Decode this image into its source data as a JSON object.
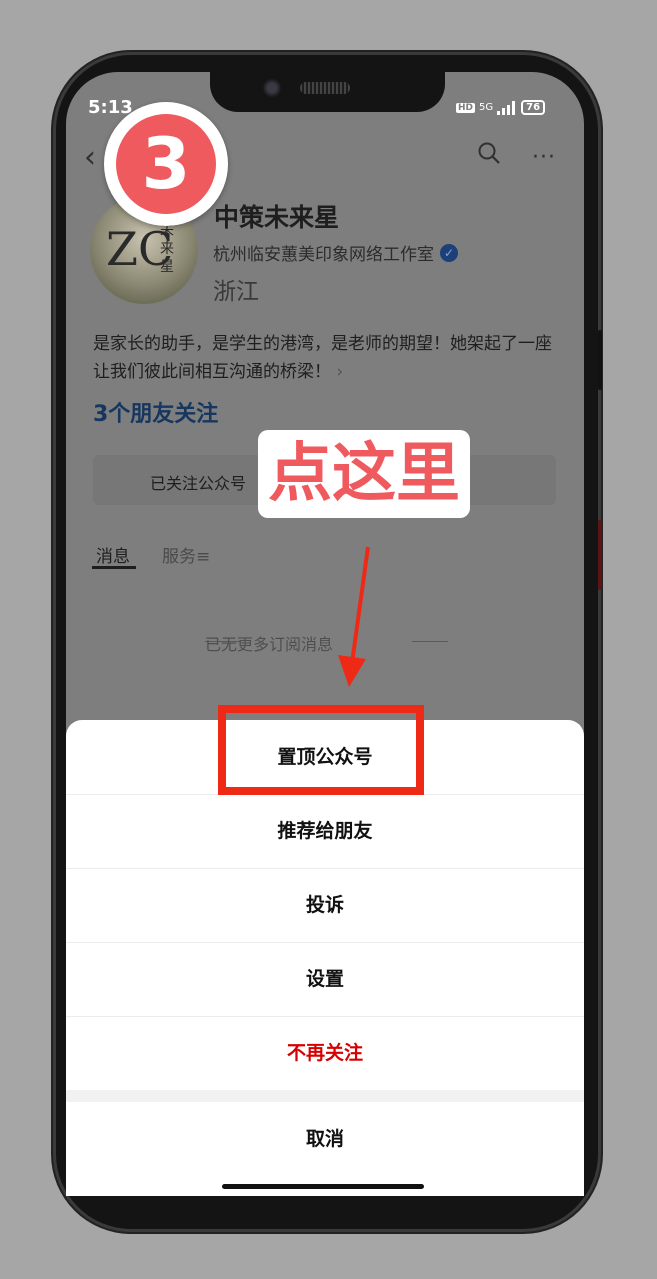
{
  "status_bar": {
    "time": "5:13",
    "hd": "HD",
    "network": "5G",
    "battery": "76"
  },
  "header": {
    "back_icon": "chevron-left-icon",
    "search_icon": "search-icon",
    "more_icon": "more-dots-icon"
  },
  "profile": {
    "avatar_text": "ZC",
    "avatar_subtext": "未来星",
    "name": "中策未来星",
    "organization": "杭州临安蕙美印象网络工作室",
    "verified_icon": "verified-check-icon",
    "region": "浙江",
    "description": "是家长的助手，是学生的港湾，是老师的期望！她架起了一座让我们彼此间相互沟通的桥梁！",
    "description_arrow": "›",
    "friends_following": "3个朋友关注",
    "follow_status": "已关注公众号"
  },
  "tabs": [
    {
      "label": "消息"
    },
    {
      "label": "服务≡"
    }
  ],
  "empty_note": "已无更多订阅消息",
  "action_sheet": {
    "items": [
      {
        "label": "置顶公众号"
      },
      {
        "label": "推荐给朋友"
      },
      {
        "label": "投诉"
      },
      {
        "label": "设置"
      },
      {
        "label": "不再关注",
        "danger": true
      }
    ],
    "cancel": "取消"
  },
  "annotation": {
    "step_number": "3",
    "callout_text": "点这里",
    "highlight_color": "#ee2a16",
    "accent_color": "#ef5a5f"
  }
}
